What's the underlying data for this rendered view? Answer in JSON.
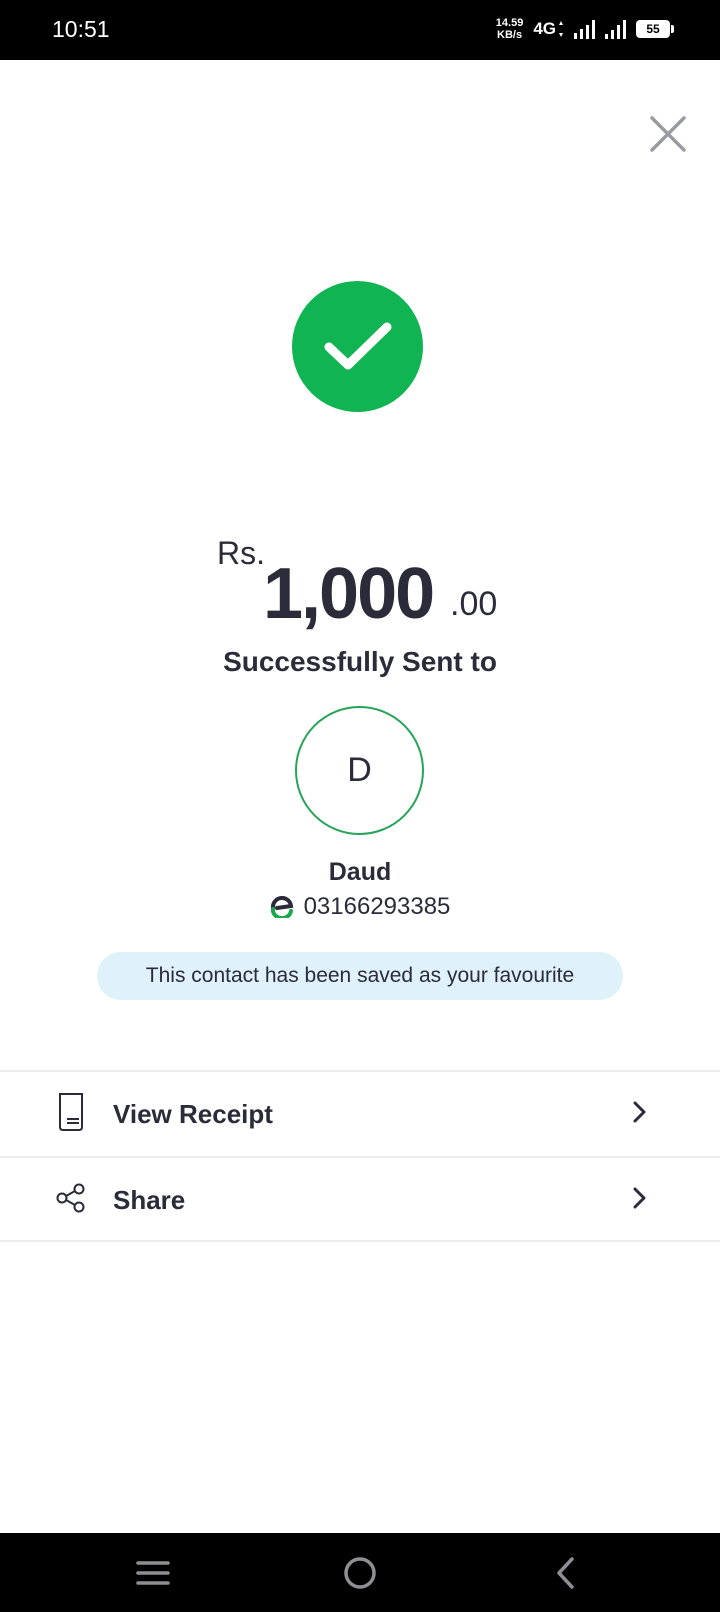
{
  "status_bar": {
    "time": "10:51",
    "net_speed_value": "14.59",
    "net_speed_unit": "KB/s",
    "network_type": "4G",
    "battery": "55"
  },
  "payment": {
    "currency": "Rs.",
    "amount_whole": "1,000",
    "amount_decimal": ".00",
    "status_text": "Successfully Sent to"
  },
  "recipient": {
    "initial": "D",
    "name": "Daud",
    "number": "03166293385",
    "favourite_notice": "This contact has been saved as your favourite"
  },
  "actions": [
    {
      "label": "View Receipt",
      "icon": "receipt-icon"
    },
    {
      "label": "Share",
      "icon": "share-icon"
    }
  ],
  "colors": {
    "success_green": "#10b453",
    "avatar_border": "#25a558",
    "pill_bg": "#dff1fb",
    "text_primary": "#2b2b3a"
  }
}
